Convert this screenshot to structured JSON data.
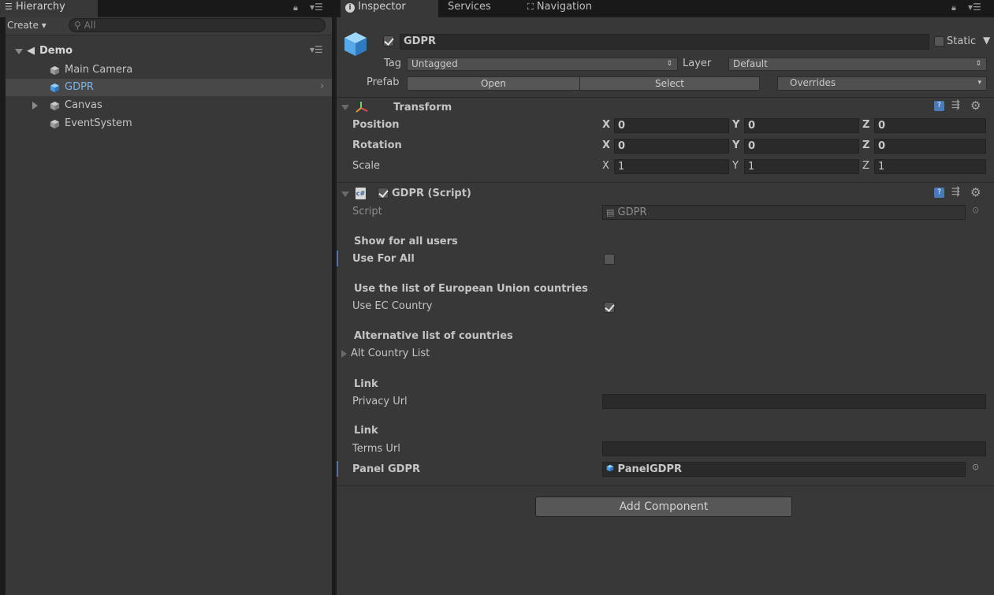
{
  "hierarchy": {
    "tab_label": "Hierarchy",
    "create_label": "Create",
    "search_placeholder": "All",
    "scene_name": "Demo",
    "items": [
      {
        "label": "Main Camera"
      },
      {
        "label": "GDPR"
      },
      {
        "label": "Canvas"
      },
      {
        "label": "EventSystem"
      }
    ]
  },
  "tabs": {
    "inspector": "Inspector",
    "services": "Services",
    "navigation": "Navigation"
  },
  "object": {
    "name": "GDPR",
    "active": true,
    "static_label": "Static",
    "tag_label": "Tag",
    "tag_value": "Untagged",
    "layer_label": "Layer",
    "layer_value": "Default",
    "prefab_label": "Prefab",
    "prefab_open": "Open",
    "prefab_select": "Select",
    "prefab_overrides": "Overrides"
  },
  "transform": {
    "title": "Transform",
    "rows": [
      {
        "label": "Position",
        "x": "0",
        "y": "0",
        "z": "0"
      },
      {
        "label": "Rotation",
        "x": "0",
        "y": "0",
        "z": "0"
      },
      {
        "label": "Scale",
        "x": "1",
        "y": "1",
        "z": "1"
      }
    ],
    "axis_x": "X",
    "axis_y": "Y",
    "axis_z": "Z"
  },
  "script_component": {
    "title": "GDPR (Script)",
    "script_label": "Script",
    "script_value": "GDPR",
    "header_show_all": "Show for all users",
    "use_for_all_label": "Use For All",
    "use_for_all": false,
    "header_eu_list": "Use the list of European Union countries",
    "use_ec_label": "Use EC Country",
    "use_ec": true,
    "header_alt_list": "Alternative list of countries",
    "alt_list_label": "Alt Country List",
    "header_link1": "Link",
    "privacy_label": "Privacy Url",
    "privacy_value": "",
    "header_link2": "Link",
    "terms_label": "Terms Url",
    "terms_value": "",
    "panel_label": "Panel GDPR",
    "panel_value": "PanelGDPR"
  },
  "add_component_label": "Add Component",
  "colors": {
    "selection": "#3e5f96",
    "cube_blue": "#5aa5e6",
    "accent_blue": "#3a79c9"
  }
}
